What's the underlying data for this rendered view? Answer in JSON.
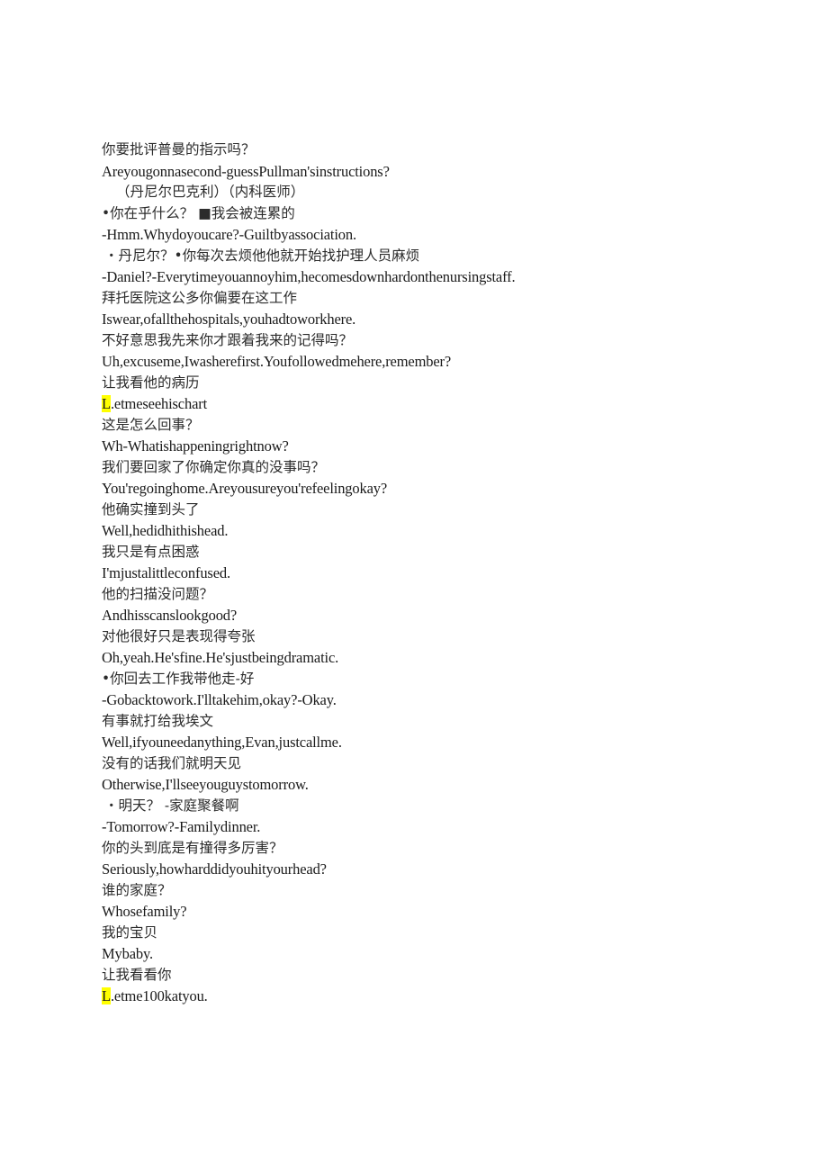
{
  "document": {
    "type": "bilingual-subtitle-transcript",
    "highlight_color": "#ffff00",
    "page_background": "#ffffff",
    "lines": [
      {
        "id": "l01",
        "lang": "zh",
        "style": "normal",
        "text": "你要批评普曼的指示吗？"
      },
      {
        "id": "l02",
        "lang": "en",
        "style": "normal",
        "text": "Areyougonnasecond-guessPullman'sinstructions?"
      },
      {
        "id": "l03",
        "lang": "zh",
        "style": "indent",
        "text": "（丹尼尔巴克利）（内科医师）"
      },
      {
        "id": "l04",
        "lang": "zh",
        "style": "normal",
        "text": "•你在乎什么？ ■我会被连累的"
      },
      {
        "id": "l05",
        "lang": "en",
        "style": "normal",
        "text": "-Hmm.Whydoyoucare?-Guiltbyassociation."
      },
      {
        "id": "l06",
        "lang": "zh",
        "style": "dot-indent",
        "text": "・丹尼尔？•你每次去烦他他就开始找护理人员麻烦"
      },
      {
        "id": "l07",
        "lang": "en",
        "style": "normal",
        "text": "-Daniel?-Everytimeyouannoyhim,hecomesdownhardonthenursingstaff."
      },
      {
        "id": "l08",
        "lang": "zh",
        "style": "normal",
        "text": "拜托医院这公多你偏要在这工作"
      },
      {
        "id": "l09",
        "lang": "en",
        "style": "normal",
        "text": "Iswear,ofallthehospitals,youhadtoworkhere."
      },
      {
        "id": "l10",
        "lang": "zh",
        "style": "normal",
        "text": "不好意思我先来你才跟着我来的记得吗？"
      },
      {
        "id": "l11",
        "lang": "en",
        "style": "normal",
        "text": "Uh,excuseme,Iwasherefirst.Youfollowedmehere,remember?"
      },
      {
        "id": "l12",
        "lang": "zh",
        "style": "normal",
        "text": "让我看他的病历"
      },
      {
        "id": "l13",
        "lang": "en",
        "style": "highlight-first",
        "highlight": "L",
        "text": "L.etmeseehischart"
      },
      {
        "id": "l14",
        "lang": "zh",
        "style": "normal",
        "text": "这是怎么回事？"
      },
      {
        "id": "l15",
        "lang": "en",
        "style": "normal",
        "text": "Wh-Whatishappeningrightnow?"
      },
      {
        "id": "l16",
        "lang": "zh",
        "style": "normal",
        "text": "我们要回家了你确定你真的没事吗？"
      },
      {
        "id": "l17",
        "lang": "en",
        "style": "normal",
        "text": "You'regoinghome.Areyousureyou'refeelingokay?"
      },
      {
        "id": "l18",
        "lang": "zh",
        "style": "normal",
        "text": "他确实撞到头了"
      },
      {
        "id": "l19",
        "lang": "en",
        "style": "normal",
        "text": "Well,hedidhithishead."
      },
      {
        "id": "l20",
        "lang": "zh",
        "style": "normal",
        "text": "我只是有点困惑"
      },
      {
        "id": "l21",
        "lang": "en",
        "style": "normal",
        "text": "I'mjustalittleconfused."
      },
      {
        "id": "l22",
        "lang": "zh",
        "style": "normal",
        "text": "他的扫描没问题？"
      },
      {
        "id": "l23",
        "lang": "en",
        "style": "normal",
        "text": "Andhisscanslookgood?"
      },
      {
        "id": "l24",
        "lang": "zh",
        "style": "normal",
        "text": "对他很好只是表现得夸张"
      },
      {
        "id": "l25",
        "lang": "en",
        "style": "normal",
        "text": "Oh,yeah.He'sfine.He'sjustbeingdramatic."
      },
      {
        "id": "l26",
        "lang": "zh",
        "style": "normal",
        "text": "•你回去工作我带他走-好"
      },
      {
        "id": "l27",
        "lang": "en",
        "style": "normal",
        "text": "-Gobacktowork.I'lltakehim,okay?-Okay."
      },
      {
        "id": "l28",
        "lang": "zh",
        "style": "normal",
        "text": "有事就打给我埃文"
      },
      {
        "id": "l29",
        "lang": "en",
        "style": "normal",
        "text": "Well,ifyouneedanything,Evan,justcallme."
      },
      {
        "id": "l30",
        "lang": "zh",
        "style": "normal",
        "text": "没有的话我们就明天见"
      },
      {
        "id": "l31",
        "lang": "en",
        "style": "normal",
        "text": "Otherwise,I'llseeyouguystomorrow."
      },
      {
        "id": "l32",
        "lang": "zh",
        "style": "dot-indent",
        "text": "・明天？ -家庭聚餐啊"
      },
      {
        "id": "l33",
        "lang": "en",
        "style": "normal",
        "text": "-Tomorrow?-Familydinner."
      },
      {
        "id": "l34",
        "lang": "zh",
        "style": "normal",
        "text": "你的头到底是有撞得多厉害？"
      },
      {
        "id": "l35",
        "lang": "en",
        "style": "normal",
        "text": "Seriously,howharddidyouhityourhead?"
      },
      {
        "id": "l36",
        "lang": "zh",
        "style": "normal",
        "text": "谁的家庭？"
      },
      {
        "id": "l37",
        "lang": "en",
        "style": "normal",
        "text": "Whosefamily?"
      },
      {
        "id": "l38",
        "lang": "zh",
        "style": "normal",
        "text": "我的宝贝"
      },
      {
        "id": "l39",
        "lang": "en",
        "style": "normal",
        "text": "Mybaby."
      },
      {
        "id": "l40",
        "lang": "zh",
        "style": "normal",
        "text": "让我看看你"
      },
      {
        "id": "l41",
        "lang": "en",
        "style": "highlight-first",
        "highlight": "L",
        "text": "L.etme100katyou."
      }
    ]
  }
}
